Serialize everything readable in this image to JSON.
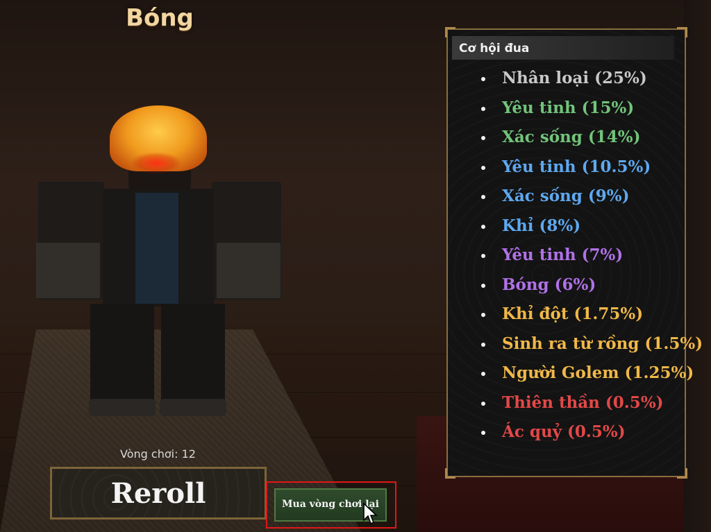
{
  "race": {
    "name": "Bóng"
  },
  "odds_panel": {
    "title": "Cơ hội đua",
    "items": [
      {
        "label": "Nhân loại (25%)",
        "color": "#c8c8c8"
      },
      {
        "label": "Yêu tinh (15%)",
        "color": "#72c47a"
      },
      {
        "label": "Xác sống (14%)",
        "color": "#72c47a"
      },
      {
        "label": "Yêu tinh (10.5%)",
        "color": "#5ea8f0"
      },
      {
        "label": "Xác sống (9%)",
        "color": "#5ea8f0"
      },
      {
        "label": "Khỉ (8%)",
        "color": "#5ea8f0"
      },
      {
        "label": "Yêu tinh (7%)",
        "color": "#b072e8"
      },
      {
        "label": "Bóng (6%)",
        "color": "#b072e8"
      },
      {
        "label": "Khỉ đột (1.75%)",
        "color": "#f0b848"
      },
      {
        "label": "Sinh ra từ rồng (1.5%)",
        "color": "#f0b848"
      },
      {
        "label": "Người Golem (1.25%)",
        "color": "#f0b848"
      },
      {
        "label": "Thiên thần (0.5%)",
        "color": "#e24848"
      },
      {
        "label": "Ác quỷ (0.5%)",
        "color": "#e24848"
      }
    ]
  },
  "controls": {
    "spins_label": "Vòng chơi: 12",
    "reroll_label": "Reroll",
    "buy_label": "Mua vòng chơi lại",
    "highlight_color": "#e01818"
  },
  "icons": {
    "cursor": "pointer-cursor-icon"
  }
}
